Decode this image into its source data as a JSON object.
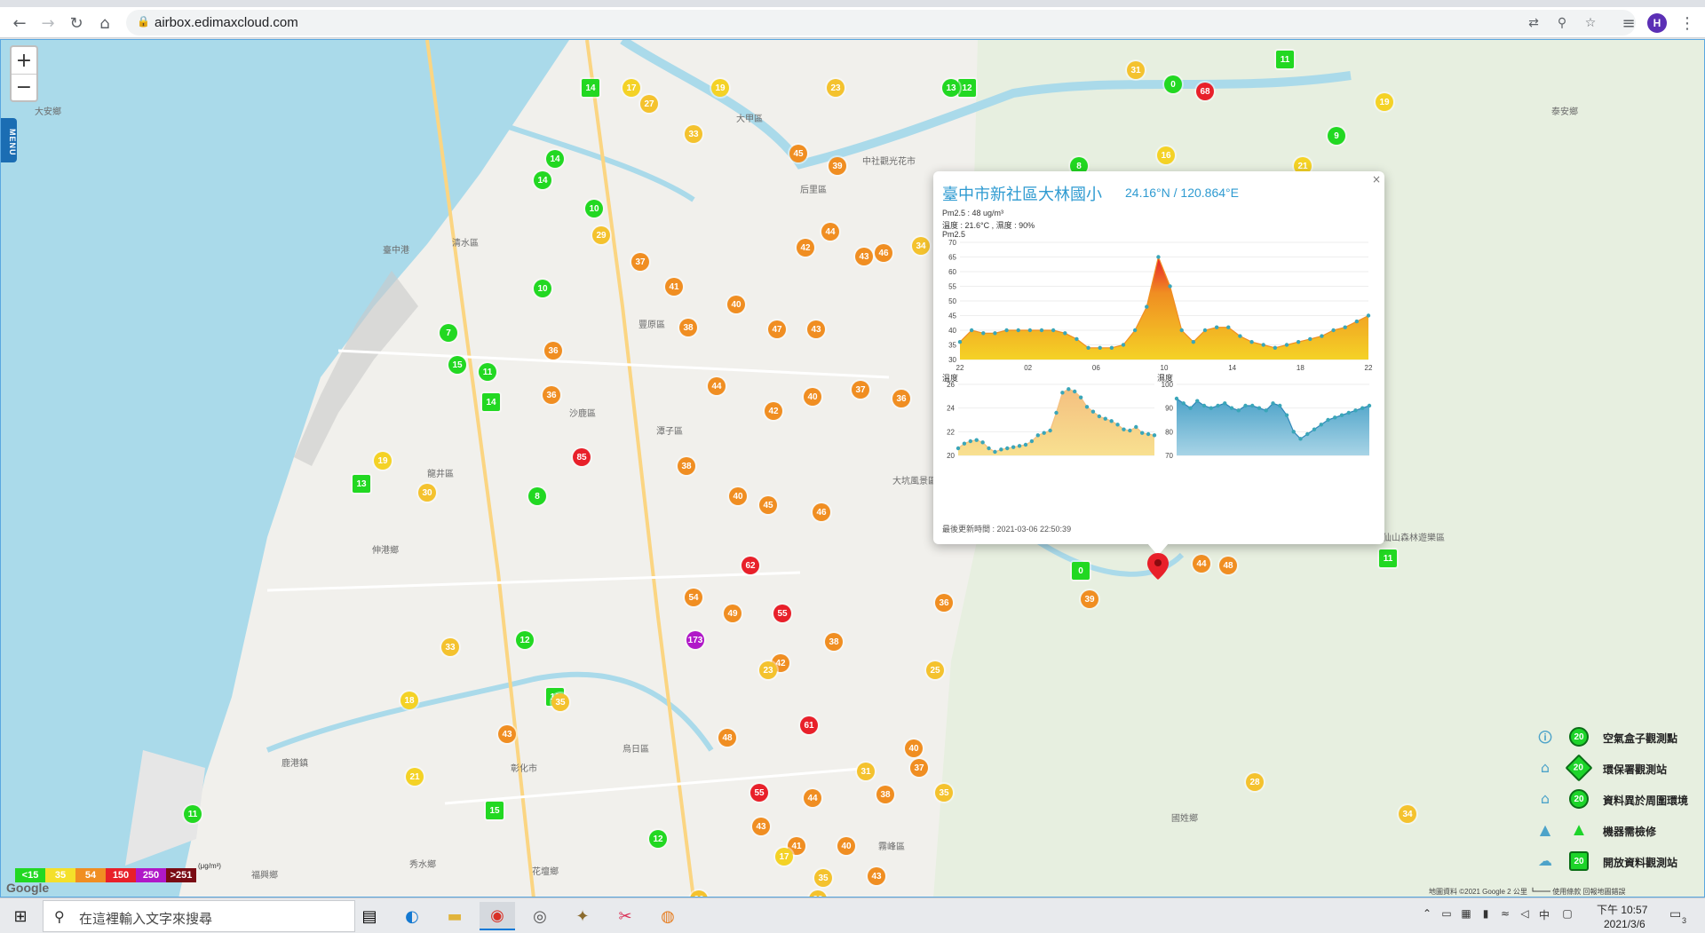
{
  "browser": {
    "url": "airbox.edimaxcloud.com",
    "profile_initial": "H"
  },
  "map": {
    "zoom_in": "+",
    "zoom_out": "−",
    "menu_label": "MENU",
    "google": "Google",
    "attribution": "地圖資料 ©2021 Google   2 公里 ┗━━   使用條款   回報地圖錯誤",
    "places": [
      {
        "name": "大安鄉"
      },
      {
        "name": "中社觀光花市"
      },
      {
        "name": "臺中港"
      },
      {
        "name": "沙鹿區"
      },
      {
        "name": "龍井區"
      },
      {
        "name": "伸港鄉"
      },
      {
        "name": "鹿港鎮"
      },
      {
        "name": "彰化市"
      },
      {
        "name": "福興鄉"
      },
      {
        "name": "秀水鄉"
      },
      {
        "name": "花壇鄉"
      },
      {
        "name": "烏日區"
      },
      {
        "name": "大坑風景區"
      },
      {
        "name": "新社區"
      },
      {
        "name": "國姓鄉"
      },
      {
        "name": "八仙山森林遊樂區"
      },
      {
        "name": "泰安鄉"
      },
      {
        "name": "霧峰區"
      },
      {
        "name": "大甲區"
      },
      {
        "name": "后里區"
      },
      {
        "name": "清水區"
      },
      {
        "name": "豐原區"
      },
      {
        "name": "潭子區"
      },
      {
        "name": "太平區"
      }
    ],
    "markers": [
      {
        "v": "14",
        "c": "#22d822"
      },
      {
        "v": "17",
        "c": "#f4d226"
      },
      {
        "v": "19",
        "c": "#f4d226"
      },
      {
        "v": "23",
        "c": "#f4c22e"
      },
      {
        "v": "12",
        "c": "#22d822"
      },
      {
        "v": "31",
        "c": "#f4c22e"
      },
      {
        "v": "13",
        "c": "#22d822"
      },
      {
        "v": "68",
        "c": "#e8202a"
      },
      {
        "v": "11",
        "c": "#22d822"
      },
      {
        "v": "0",
        "c": "#22d822"
      },
      {
        "v": "19",
        "c": "#f4d226"
      },
      {
        "v": "14",
        "c": "#22d822"
      },
      {
        "v": "27",
        "c": "#f4c22e"
      },
      {
        "v": "33",
        "c": "#f4c22e"
      },
      {
        "v": "45",
        "c": "#f08e22"
      },
      {
        "v": "39",
        "c": "#f08e22"
      },
      {
        "v": "21",
        "c": "#f4d226"
      },
      {
        "v": "9",
        "c": "#22d822"
      },
      {
        "v": "16",
        "c": "#f4d226"
      },
      {
        "v": "8",
        "c": "#22d822"
      },
      {
        "v": "21",
        "c": "#f4d226"
      },
      {
        "v": "14",
        "c": "#22d822"
      },
      {
        "v": "10",
        "c": "#22d822"
      },
      {
        "v": "29",
        "c": "#f4c22e"
      },
      {
        "v": "42",
        "c": "#f08e22"
      },
      {
        "v": "44",
        "c": "#f08e22"
      },
      {
        "v": "43",
        "c": "#f08e22"
      },
      {
        "v": "46",
        "c": "#f08e22"
      },
      {
        "v": "34",
        "c": "#f4c22e"
      },
      {
        "v": "37",
        "c": "#f08e22"
      },
      {
        "v": "41",
        "c": "#f08e22"
      },
      {
        "v": "10",
        "c": "#22d822"
      },
      {
        "v": "38",
        "c": "#f08e22"
      },
      {
        "v": "40",
        "c": "#f08e22"
      },
      {
        "v": "47",
        "c": "#f08e22"
      },
      {
        "v": "43",
        "c": "#f08e22"
      },
      {
        "v": "36",
        "c": "#f08e22"
      },
      {
        "v": "7",
        "c": "#22d822"
      },
      {
        "v": "15",
        "c": "#22d822"
      },
      {
        "v": "11",
        "c": "#22d822"
      },
      {
        "v": "14",
        "c": "#22d822"
      },
      {
        "v": "36",
        "c": "#f08e22"
      },
      {
        "v": "44",
        "c": "#f08e22"
      },
      {
        "v": "42",
        "c": "#f08e22"
      },
      {
        "v": "40",
        "c": "#f08e22"
      },
      {
        "v": "37",
        "c": "#f08e22"
      },
      {
        "v": "36",
        "c": "#f08e22"
      },
      {
        "v": "85",
        "c": "#e8202a"
      },
      {
        "v": "13",
        "c": "#22d822"
      },
      {
        "v": "8",
        "c": "#22d822"
      },
      {
        "v": "19",
        "c": "#f4d226"
      },
      {
        "v": "30",
        "c": "#f4c22e"
      },
      {
        "v": "38",
        "c": "#f08e22"
      },
      {
        "v": "40",
        "c": "#f08e22"
      },
      {
        "v": "45",
        "c": "#f08e22"
      },
      {
        "v": "46",
        "c": "#f08e22"
      },
      {
        "v": "62",
        "c": "#e8202a"
      },
      {
        "v": "55",
        "c": "#e8202a"
      },
      {
        "v": "173",
        "c": "#b018c8"
      },
      {
        "v": "54",
        "c": "#f08e22"
      },
      {
        "v": "49",
        "c": "#f08e22"
      },
      {
        "v": "42",
        "c": "#f08e22"
      },
      {
        "v": "38",
        "c": "#f08e22"
      },
      {
        "v": "12",
        "c": "#22d822"
      },
      {
        "v": "10",
        "c": "#22d822"
      },
      {
        "v": "23",
        "c": "#f4c22e"
      },
      {
        "v": "61",
        "c": "#e8202a"
      },
      {
        "v": "48",
        "c": "#f08e22"
      },
      {
        "v": "55",
        "c": "#e8202a"
      },
      {
        "v": "44",
        "c": "#f08e22"
      },
      {
        "v": "43",
        "c": "#f08e22"
      },
      {
        "v": "41",
        "c": "#f08e22"
      },
      {
        "v": "40",
        "c": "#f08e22"
      },
      {
        "v": "35",
        "c": "#f4c22e"
      },
      {
        "v": "17",
        "c": "#f4d226"
      },
      {
        "v": "26",
        "c": "#f4c22e"
      },
      {
        "v": "33",
        "c": "#f4c22e"
      },
      {
        "v": "43",
        "c": "#f08e22"
      },
      {
        "v": "37",
        "c": "#f08e22"
      },
      {
        "v": "12",
        "c": "#22d822"
      },
      {
        "v": "15",
        "c": "#22d822"
      },
      {
        "v": "11",
        "c": "#22d822"
      },
      {
        "v": "21",
        "c": "#f4d226"
      },
      {
        "v": "18",
        "c": "#f4d226"
      },
      {
        "v": "33",
        "c": "#f4c22e"
      },
      {
        "v": "35",
        "c": "#f4c22e"
      },
      {
        "v": "43",
        "c": "#f08e22"
      },
      {
        "v": "25",
        "c": "#f4c22e"
      },
      {
        "v": "40",
        "c": "#f08e22"
      },
      {
        "v": "38",
        "c": "#f08e22"
      },
      {
        "v": "31",
        "c": "#f4c22e"
      },
      {
        "v": "36",
        "c": "#f08e22"
      },
      {
        "v": "0",
        "c": "#22d822"
      },
      {
        "v": "39",
        "c": "#f08e22"
      },
      {
        "v": "44",
        "c": "#f08e22"
      },
      {
        "v": "48",
        "c": "#f08e22"
      },
      {
        "v": "11",
        "c": "#22d822"
      },
      {
        "v": "34",
        "c": "#f4c22e"
      },
      {
        "v": "28",
        "c": "#f4c22e"
      },
      {
        "v": "35",
        "c": "#f4c22e"
      }
    ]
  },
  "popup": {
    "title": "臺中市新社區大林國小",
    "coords": "24.16°N / 120.864°E",
    "pm_line": "Pm2.5 : 48 ug/m³",
    "temp_line": "溫度 : 21.6°C , 濕度 : 90%",
    "pm_label": "Pm2.5",
    "temp_label": "溫度",
    "hum_label": "濕度",
    "updated": "最後更新時間 : 2021-03-06 22:50:39",
    "close": "×"
  },
  "chart_data": [
    {
      "type": "area",
      "title": "Pm2.5",
      "x_ticks": [
        "22",
        "02",
        "06",
        "10",
        "14",
        "18",
        "22"
      ],
      "ylim": [
        30,
        70
      ],
      "y_ticks": [
        30,
        35,
        40,
        45,
        50,
        55,
        60,
        65,
        70
      ],
      "values": [
        36,
        40,
        39,
        39,
        40,
        40,
        40,
        40,
        40,
        39,
        37,
        34,
        34,
        34,
        35,
        40,
        48,
        65,
        55,
        40,
        36,
        40,
        41,
        41,
        38,
        36,
        35,
        34,
        35,
        36,
        37,
        38,
        40,
        41,
        43,
        45
      ]
    },
    {
      "type": "area",
      "title": "溫度",
      "ylim": [
        20,
        26
      ],
      "y_ticks": [
        20,
        22,
        24,
        26
      ],
      "values": [
        20.6,
        21.0,
        21.2,
        21.3,
        21.1,
        20.6,
        20.3,
        20.5,
        20.6,
        20.7,
        20.8,
        20.9,
        21.2,
        21.7,
        21.9,
        22.1,
        23.6,
        25.3,
        25.6,
        25.4,
        24.9,
        24.1,
        23.7,
        23.3,
        23.1,
        22.9,
        22.6,
        22.2,
        22.1,
        22.4,
        21.9,
        21.8,
        21.7
      ]
    },
    {
      "type": "area",
      "title": "濕度",
      "ylim": [
        70,
        100
      ],
      "y_ticks": [
        70,
        80,
        90,
        100
      ],
      "values": [
        94,
        92,
        90,
        93,
        91,
        90,
        91,
        92,
        90,
        89,
        91,
        91,
        90,
        89,
        92,
        91,
        87,
        80,
        77,
        79,
        81,
        83,
        85,
        86,
        87,
        88,
        89,
        90,
        91
      ]
    }
  ],
  "aqi_legend": [
    {
      "label": "<15",
      "color": "#22d822"
    },
    {
      "label": "35",
      "color": "#f4e02a"
    },
    {
      "label": "54",
      "color": "#f08e22"
    },
    {
      "label": "150",
      "color": "#e8202a"
    },
    {
      "label": "250",
      "color": "#b018c8"
    },
    {
      "label": ">251",
      "color": "#7a0b14"
    }
  ],
  "aqi_unit": "(μg/m³)",
  "type_legend": [
    {
      "label": "空氣盒子觀測點",
      "badge": "20",
      "icon": "🛈"
    },
    {
      "label": "環保署觀測站",
      "badge": "20",
      "icon": "⌂"
    },
    {
      "label": "資料異於周圍環境",
      "badge": "20",
      "icon": "⌂"
    },
    {
      "label": "機器需檢修",
      "badge": "",
      "icon": "▲"
    },
    {
      "label": "開放資料觀測站",
      "badge": "20",
      "icon": "☁"
    }
  ],
  "taskbar": {
    "search_placeholder": "在這裡輸入文字來搜尋",
    "time": "下午 10:57",
    "date": "2021/3/6",
    "ime": "中",
    "notif_count": "3"
  }
}
